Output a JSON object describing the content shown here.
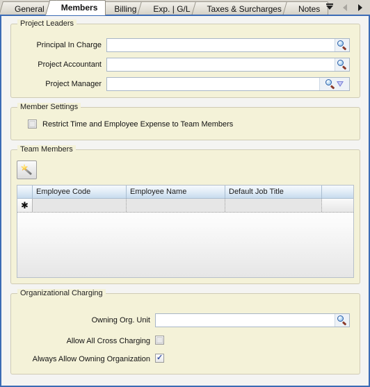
{
  "tabs": {
    "items": [
      {
        "label": "General",
        "active": false
      },
      {
        "label": "Members",
        "active": true
      },
      {
        "label": "Billing",
        "active": false
      },
      {
        "label": "Exp. | G/L",
        "active": false
      },
      {
        "label": "Taxes & Surcharges",
        "active": false
      },
      {
        "label": "Notes",
        "active": false
      }
    ],
    "nav": {
      "list_icon": "tab-list-dropdown-icon",
      "prev_icon": "tab-scroll-left-icon",
      "next_icon": "tab-scroll-right-icon"
    }
  },
  "project_leaders": {
    "title": "Project Leaders",
    "fields": [
      {
        "label": "Principal In Charge",
        "value": "",
        "placeholder": "",
        "lookup_icon": "magnifier-icon",
        "has_dropdown": false
      },
      {
        "label": "Project Accountant",
        "value": "",
        "placeholder": "",
        "lookup_icon": "magnifier-icon",
        "has_dropdown": false
      },
      {
        "label": "Project Manager",
        "value": "",
        "placeholder": "",
        "lookup_icon": "magnifier-icon",
        "has_dropdown": true,
        "dropdown_icon": "chevron-down-icon"
      }
    ]
  },
  "member_settings": {
    "title": "Member Settings",
    "restrict_label": "Restrict Time and Employee Expense to Team Members",
    "restrict_checked": false,
    "restrict_disabled": true
  },
  "team_members": {
    "title": "Team Members",
    "toolbar": {
      "wizard_button_name": "magic-wand-button",
      "wizard_icon": "magic-wand-icon"
    },
    "grid": {
      "columns": [
        "Employee Code",
        "Employee Name",
        "Default Job Title",
        ""
      ],
      "new_row_marker": "✱",
      "row_action_icon": "people-icon",
      "rows": []
    }
  },
  "organizational_charging": {
    "title": "Organizational Charging",
    "owning_org_unit": {
      "label": "Owning Org. Unit",
      "value": "",
      "placeholder": "",
      "lookup_icon": "magnifier-icon"
    },
    "allow_all_cross_charging": {
      "label": "Allow All Cross Charging",
      "checked": false
    },
    "always_allow_owning_organization": {
      "label": "Always Allow Owning Organization",
      "checked": true,
      "tick": "✓"
    }
  },
  "colors": {
    "group_background": "#f4f2d8",
    "page_background": "#f4f4f2",
    "page_border": "#3b6bb5",
    "grid_header": "#c8dcee",
    "accent_blue": "#2a5fa8",
    "check_blue": "#3a53a4"
  }
}
